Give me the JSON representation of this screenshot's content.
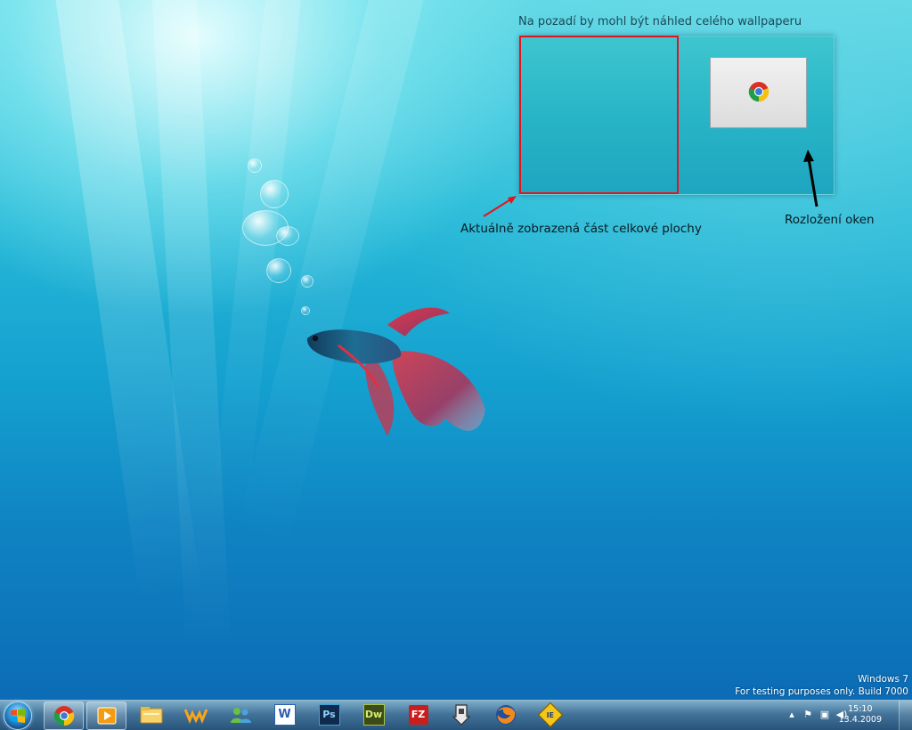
{
  "annotation": {
    "caption": "Na pozadí by mohl být náhled celého wallpaperu",
    "label_viewport": "Aktuálně zobrazená část celkové plochy",
    "label_windows": "Rozložení oken"
  },
  "watermark": {
    "line1": "Windows 7",
    "line2": "For testing purposes only. Build 7000"
  },
  "taskbar": {
    "icons": [
      {
        "name": "chrome-icon",
        "running": true
      },
      {
        "name": "media-player-icon",
        "running": true
      },
      {
        "name": "windows-explorer-icon",
        "running": false
      },
      {
        "name": "winamp-icon",
        "running": false
      },
      {
        "name": "messenger-icon",
        "running": false
      },
      {
        "name": "word-icon",
        "running": false,
        "text": "W"
      },
      {
        "name": "photoshop-icon",
        "running": false,
        "text": "Ps"
      },
      {
        "name": "dreamweaver-icon",
        "running": false,
        "text": "Dw"
      },
      {
        "name": "filezilla-icon",
        "running": false,
        "text": "FZ"
      },
      {
        "name": "download-icon",
        "running": false
      },
      {
        "name": "firefox-icon",
        "running": false
      },
      {
        "name": "ie-tester-icon",
        "running": false,
        "text": "IE"
      }
    ],
    "clock": {
      "time": "15:10",
      "date": "13.4.2009"
    },
    "tray_icons": [
      "show-hidden-icons-arrow",
      "action-center-flag-icon",
      "network-icon",
      "volume-icon"
    ]
  },
  "colors": {
    "viewport_rect": "#e3141e",
    "annotation_arrow_red": "#e3141e",
    "annotation_arrow_black": "#000000"
  }
}
